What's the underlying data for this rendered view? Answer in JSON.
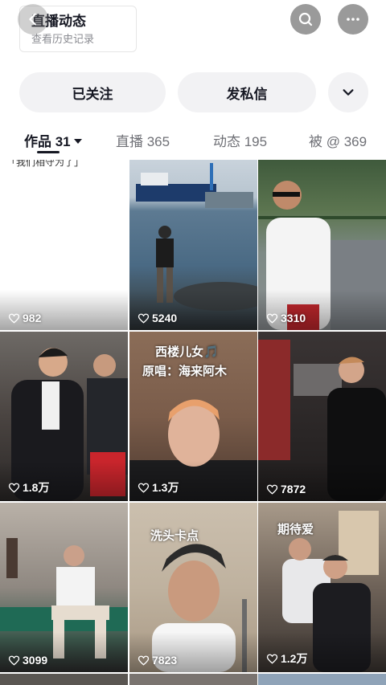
{
  "header": {
    "title": "直播动态",
    "subtitle": "查看历史记录",
    "back_icon": "chevron-left-icon",
    "search_icon": "search-icon",
    "more_icon": "ellipsis-icon"
  },
  "actions": {
    "follow_label": "已关注",
    "message_label": "发私信",
    "more_icon": "chevron-down-icon"
  },
  "tabs": [
    {
      "label": "作品 31",
      "active": true
    },
    {
      "label": "直播 365"
    },
    {
      "label": "动态 195"
    },
    {
      "label": "被 @ 369"
    }
  ],
  "grid": {
    "items": [
      {
        "likes": "982",
        "top_text": "「我们相守为了」"
      },
      {
        "likes": "5240"
      },
      {
        "likes": "3310"
      },
      {
        "likes": "1.8万"
      },
      {
        "likes": "1.3万",
        "overlay_line1": "西楼儿女🎵",
        "overlay_line2": "原唱：海来阿木"
      },
      {
        "likes": "7872"
      },
      {
        "likes": "3099"
      },
      {
        "likes": "7823",
        "overlay_line1": "洗头卡点"
      },
      {
        "likes": "1.2万",
        "overlay_line1": "期待爱"
      }
    ]
  },
  "colors": {
    "text_primary": "#161823",
    "text_secondary": "#8a8b91",
    "pill_bg": "#f2f2f4"
  }
}
